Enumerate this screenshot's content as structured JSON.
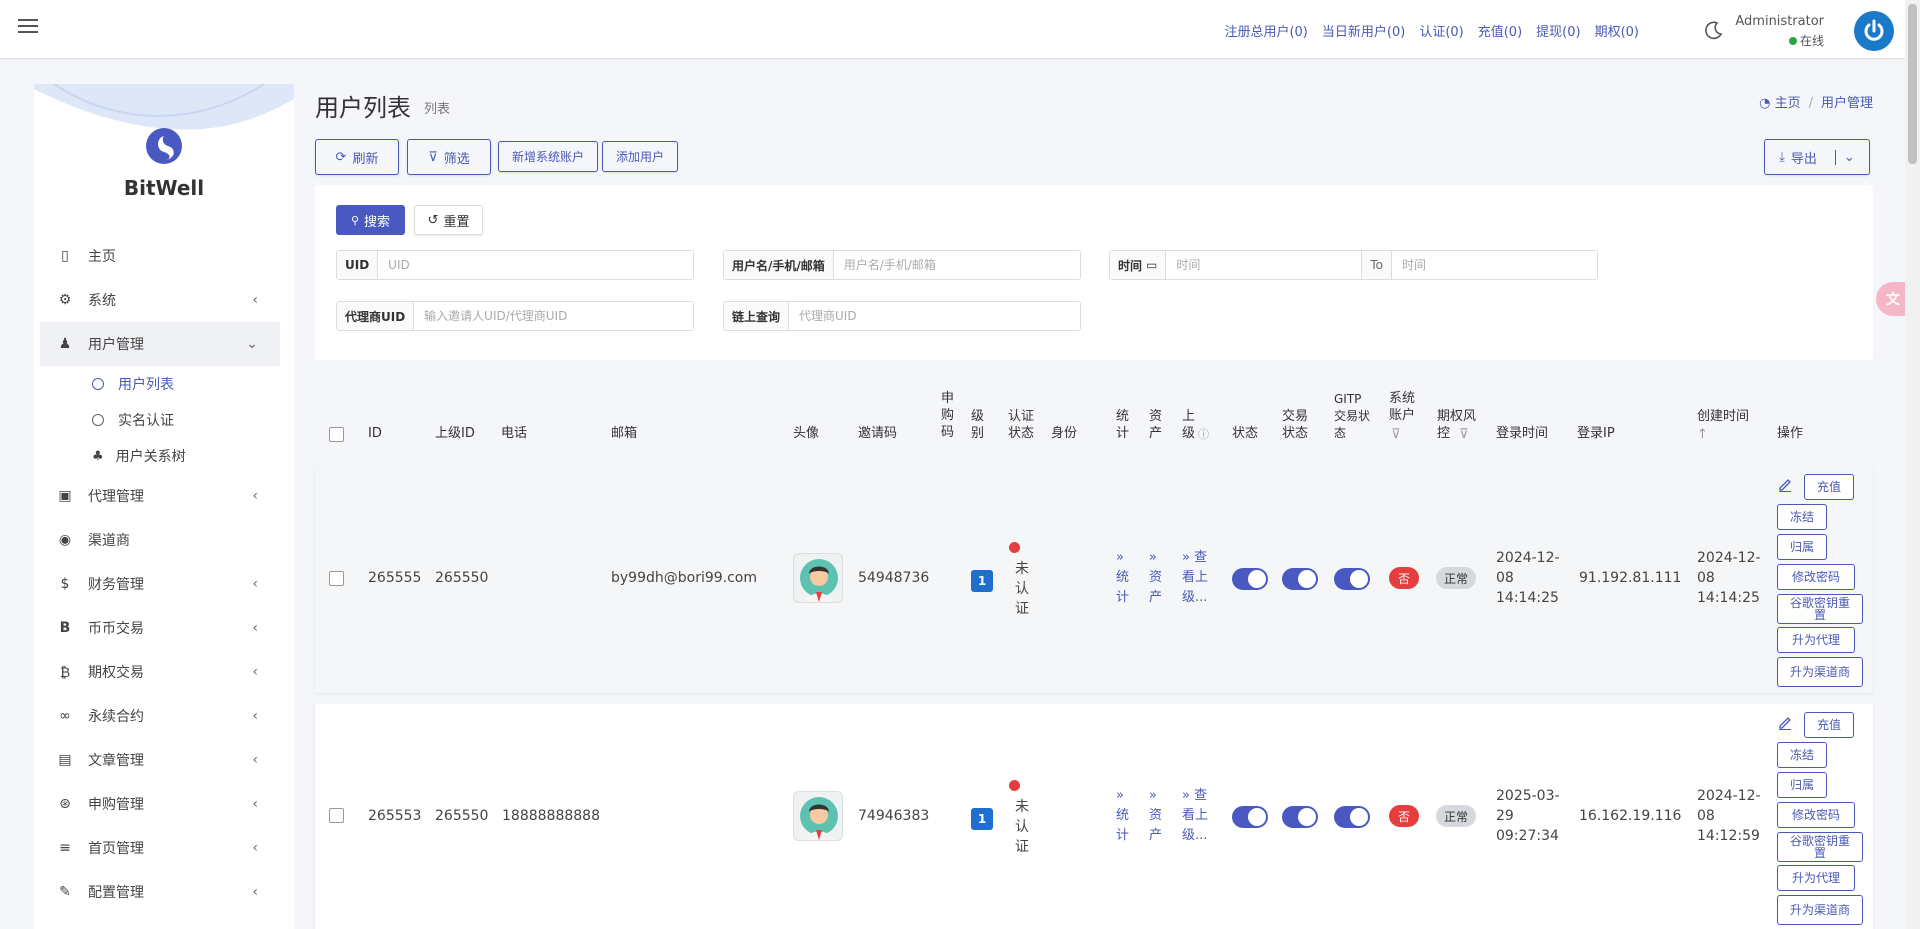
{
  "topbar": {
    "stats": [
      "注册总用户(0)",
      "当日新用户(0)",
      "认证(0)",
      "充值(0)",
      "提现(0)",
      "期权(0)"
    ],
    "admin_name": "Administrator",
    "admin_status": "在线"
  },
  "sidebar": {
    "brand": "BitWell",
    "items": [
      {
        "label": "主页"
      },
      {
        "label": "系统"
      },
      {
        "label": "用户管理"
      },
      {
        "label": "代理管理"
      },
      {
        "label": "渠道商"
      },
      {
        "label": "财务管理"
      },
      {
        "label": "币币交易"
      },
      {
        "label": "期权交易"
      },
      {
        "label": "永续合约"
      },
      {
        "label": "文章管理"
      },
      {
        "label": "申购管理"
      },
      {
        "label": "首页管理"
      },
      {
        "label": "配置管理"
      }
    ],
    "sub_items": [
      {
        "label": "用户列表"
      },
      {
        "label": "实名认证"
      },
      {
        "label": "用户关系树"
      }
    ]
  },
  "page": {
    "title": "用户列表",
    "subtitle": "列表",
    "breadcrumb_home": "主页",
    "breadcrumb_current": "用户管理"
  },
  "toolbar": {
    "refresh": "刷新",
    "filter": "筛选",
    "new_system_account": "新增系统账户",
    "add_user": "添加用户",
    "export": "导出"
  },
  "search": {
    "search_btn": "搜索",
    "reset_btn": "重置",
    "uid_label": "UID",
    "uid_placeholder": "UID",
    "username_label": "用户名/手机/邮箱",
    "username_placeholder": "用户名/手机/邮箱",
    "time_label": "时间",
    "time_placeholder": "时间",
    "to_label": "To",
    "time_to_placeholder": "时间",
    "agent_uid_label": "代理商UID",
    "agent_uid_placeholder": "输入邀请人UID/代理商UID",
    "chain_label": "链上查询",
    "chain_placeholder": "代理商UID"
  },
  "table": {
    "headers": {
      "id": "ID",
      "parent_id": "上级ID",
      "phone": "电话",
      "email": "邮箱",
      "avatar": "头像",
      "invite": "邀请码",
      "purchase": "申\n购\n码",
      "level": "级\n别",
      "auth": "认证\n状态",
      "identity": "身份",
      "stats": "统\n计",
      "assets": "资\n产",
      "parent": "上\n级",
      "status": "状态",
      "trade_status": "交易\n状态",
      "gitp": "GITP\n交易状\n态",
      "sys_account": "系统\n账户",
      "risk": "期权风\n控",
      "login_time": "登录时间",
      "login_ip": "登录IP",
      "created": "创建时间",
      "ops": "操作"
    },
    "rows": [
      {
        "id": "265555",
        "parent_id": "265550",
        "phone": "",
        "email": "by99dh@bori99.com",
        "invite": "54948736",
        "level": "1",
        "auth": "未\n认\n证",
        "stats_link": "»\n统\n计",
        "assets_link": "»\n资\n产",
        "parent_link": "» 查\n看上\n级...",
        "sys_account": "否",
        "risk": "正常",
        "login_time": "2024-12-\n08\n14:14:25",
        "login_ip": "91.192.81.111",
        "created": "2024-12-\n08\n14:14:25"
      },
      {
        "id": "265553",
        "parent_id": "265550",
        "phone": "18888888888",
        "email": "",
        "invite": "74946383",
        "level": "1",
        "auth": "未\n认\n证",
        "stats_link": "»\n统\n计",
        "assets_link": "»\n资\n产",
        "parent_link": "» 查\n看上\n级...",
        "sys_account": "否",
        "risk": "正常",
        "login_time": "2025-03-\n29\n09:27:34",
        "login_ip": "16.162.19.116",
        "created": "2024-12-\n08\n14:12:59"
      }
    ],
    "actions": {
      "recharge": "充值",
      "freeze": "冻结",
      "belong": "归属",
      "change_pwd": "修改密码",
      "google_reset": "谷歌密钥重置",
      "promote_agent": "升为代理",
      "promote_channel": "升为渠道商"
    }
  },
  "colors": {
    "accent": "#4a59b5",
    "danger": "#e53e3e",
    "online": "#28a745"
  }
}
